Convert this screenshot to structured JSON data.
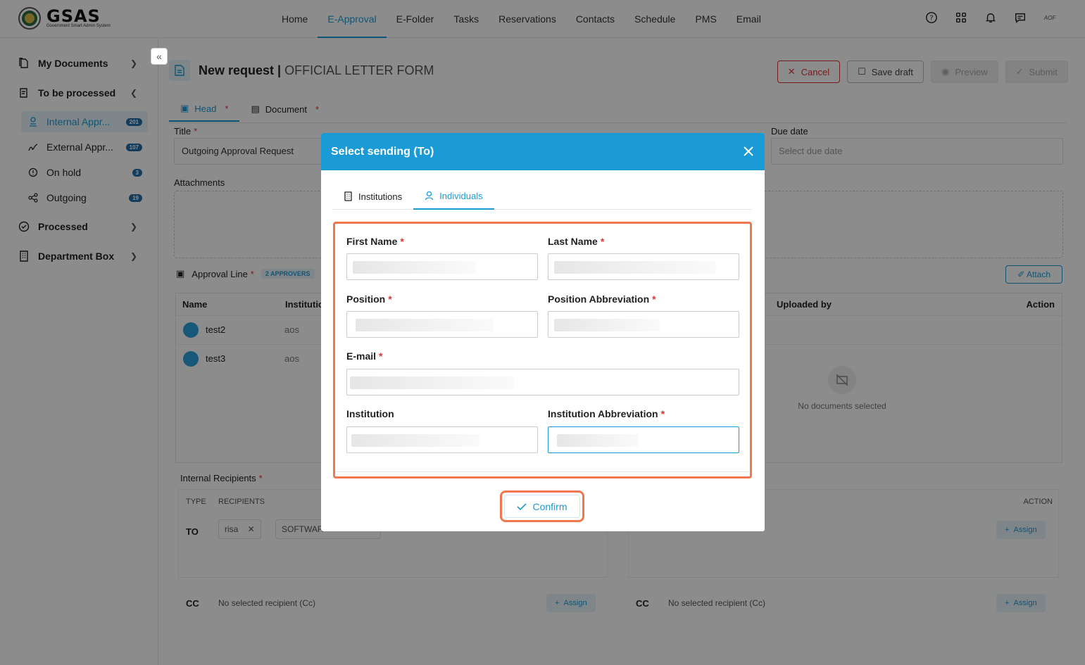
{
  "app": {
    "logo_title": "GSAS",
    "logo_sub": "Government Smart Admin System",
    "user_abbr": "AOF"
  },
  "nav": [
    "Home",
    "E-Approval",
    "E-Folder",
    "Tasks",
    "Reservations",
    "Contacts",
    "Schedule",
    "PMS",
    "Email"
  ],
  "sidebar": {
    "my_documents": "My Documents",
    "to_be_processed": "To be processed",
    "items": [
      {
        "label": "Internal Appr...",
        "badge": "201"
      },
      {
        "label": "External Appr...",
        "badge": "107"
      },
      {
        "label": "On hold",
        "badge": "3"
      },
      {
        "label": "Outgoing",
        "badge": "19"
      }
    ],
    "processed": "Processed",
    "department_box": "Department Box"
  },
  "page": {
    "title_bold": "New request |",
    "title_form": "OFFICIAL LETTER FORM",
    "buttons": {
      "cancel": "Cancel",
      "save_draft": "Save draft",
      "preview": "Preview",
      "submit": "Submit"
    },
    "tabs": {
      "head": "Head",
      "document": "Document",
      "required": "*"
    },
    "title_label": "Title",
    "title_value": "Outgoing Approval Request",
    "due_date_label": "Due date",
    "due_date_placeholder": "Select due date",
    "attachments_label": "Attachments",
    "attach_button": "Attach",
    "approval_line": "Approval Line",
    "approvers_tag": "2 APPROVERS",
    "columns": {
      "name": "Name",
      "institution": "Institutio",
      "uploaded_by": "Uploaded by",
      "action": "Action"
    },
    "approvers": [
      {
        "name": "test2",
        "institution": "aos"
      },
      {
        "name": "test3",
        "institution": "aos"
      }
    ],
    "no_documents": "No documents selected",
    "internal_recipients": "Internal Recipients",
    "recip_cols": {
      "type": "TYPE",
      "recipients": "RECIPIENTS",
      "action": "ACTION"
    },
    "to": "TO",
    "cc": "CC",
    "chip_risa": "risa",
    "chip_software": "SOFTWAR",
    "no_recipient_cc": "No selected recipient (Cc)",
    "assign": "Assign"
  },
  "modal": {
    "title": "Select sending (To)",
    "tabs": {
      "institutions": "Institutions",
      "individuals": "Individuals"
    },
    "fields": {
      "first_name": "First Name",
      "last_name": "Last Name",
      "position": "Position",
      "position_abbr": "Position Abbreviation",
      "email": "E-mail",
      "institution": "Institution",
      "institution_abbr": "Institution Abbreviation",
      "required": "*"
    },
    "confirm": "Confirm"
  },
  "colors": {
    "accent": "#1a9bd6",
    "highlight": "#f07850",
    "danger": "#dd3333"
  }
}
